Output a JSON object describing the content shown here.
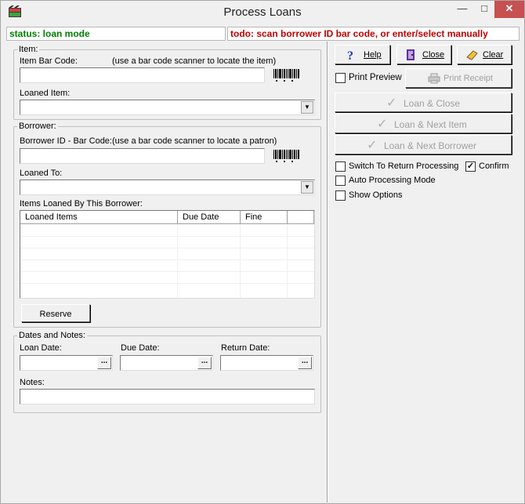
{
  "window": {
    "title": "Process Loans",
    "minimize_icon": "minimize-icon",
    "maximize_icon": "maximize-icon",
    "close_icon": "close-icon",
    "close_color": "#c75050"
  },
  "statusbar": {
    "status": "status: loan mode",
    "status_color": "#008000",
    "todo": "todo: scan borrower ID bar code, or enter/select manually",
    "todo_color": "#c00000"
  },
  "item_group": {
    "title": "Item:",
    "barcode_label": "Item Bar Code:",
    "barcode_hint": "(use a bar code scanner to locate the item)",
    "barcode_value": "",
    "loaned_item_label": "Loaned Item:",
    "loaned_item_value": ""
  },
  "borrower_group": {
    "title": "Borrower:",
    "barcode_label": "Borrower ID - Bar Code:",
    "barcode_hint": "(use a bar code scanner to locate a patron)",
    "barcode_value": "",
    "loaned_to_label": "Loaned To:",
    "loaned_to_value": "",
    "items_label": "Items Loaned By This Borrower:",
    "columns": [
      "Loaned Items",
      "Due Date",
      "Fine",
      ""
    ],
    "rows": [],
    "reserve_button": "Reserve"
  },
  "dates_group": {
    "title": "Dates and Notes:",
    "loan_date_label": "Loan Date:",
    "loan_date_value": "",
    "due_date_label": "Due Date:",
    "due_date_value": "",
    "return_date_label": "Return Date:",
    "return_date_value": "",
    "picker_label": "...",
    "notes_label": "Notes:",
    "notes_value": ""
  },
  "actions": {
    "help": "Help",
    "close": "Close",
    "clear": "Clear",
    "print_preview": "Print Preview",
    "print_preview_checked": false,
    "print_receipt": "Print Receipt",
    "loan_close": "Loan & Close",
    "loan_next_item": "Loan & Next Item",
    "loan_next_borrower": "Loan & Next Borrower",
    "switch_return": "Switch To Return Processing",
    "switch_return_checked": false,
    "confirm": "Confirm",
    "confirm_checked": true,
    "auto_processing": "Auto Processing Mode",
    "auto_processing_checked": false,
    "show_options": "Show Options",
    "show_options_checked": false
  }
}
